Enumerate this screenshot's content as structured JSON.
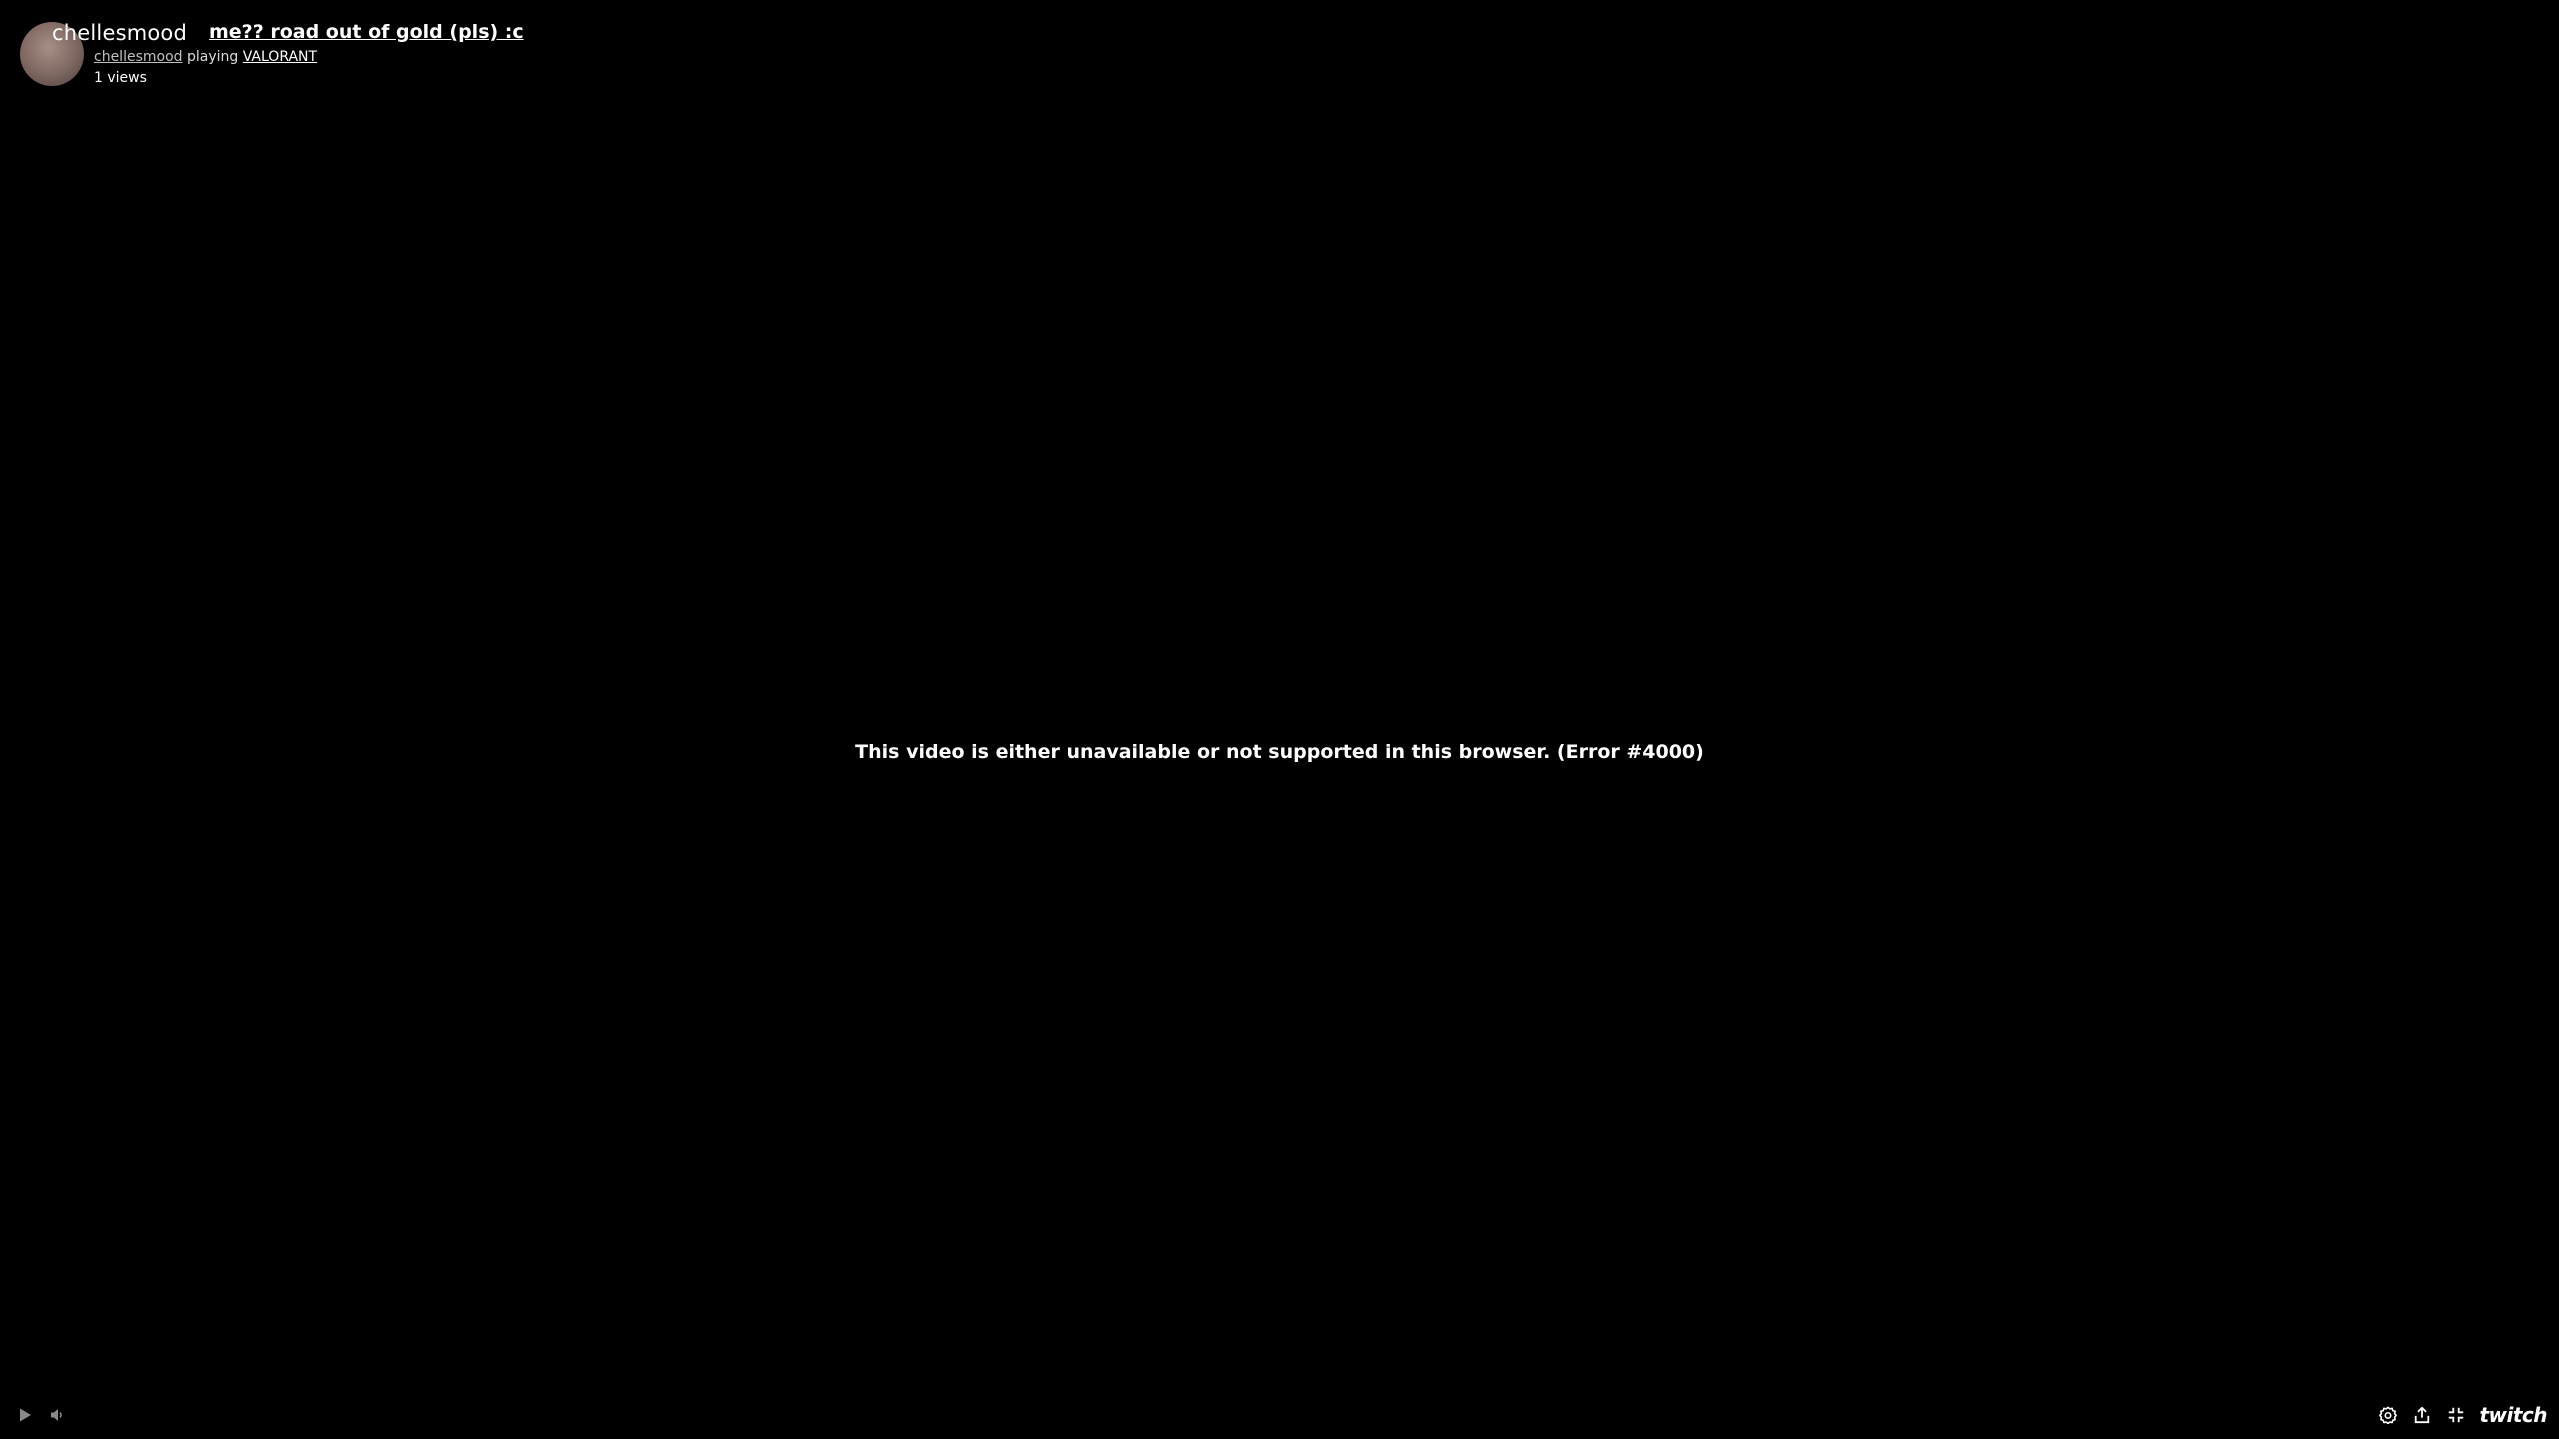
{
  "channel": {
    "name": "chellesmood",
    "streamer_link": "chellesmood",
    "playing_word": "playing",
    "game": "VALORANT"
  },
  "video": {
    "title": "me?? road out of gold (pls) :c",
    "views": "1 views"
  },
  "player": {
    "error_message": "This video is either unavailable or not supported in this browser. (Error #4000)"
  },
  "controls": {
    "left": [
      "play-icon",
      "volume-icon"
    ],
    "right": [
      "gear-icon",
      "share-icon",
      "fullscreen-exit-icon"
    ],
    "logo_text": "twitch"
  },
  "colors": {
    "background": "#000000",
    "text": "#ffffff"
  }
}
